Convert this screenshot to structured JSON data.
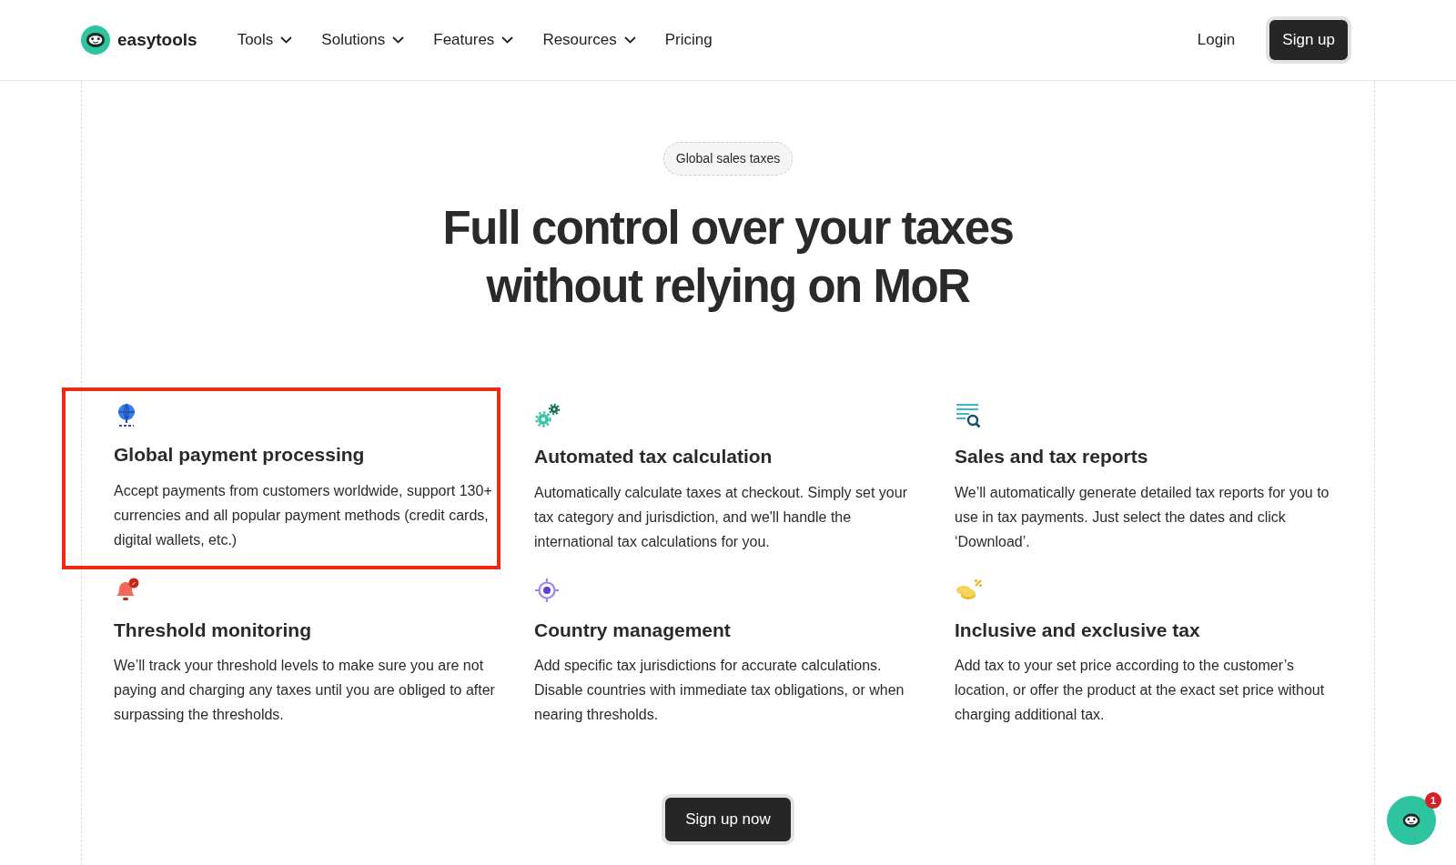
{
  "brand": {
    "name": "easytools"
  },
  "nav": [
    {
      "label": "Tools",
      "dropdown": true
    },
    {
      "label": "Solutions",
      "dropdown": true
    },
    {
      "label": "Features",
      "dropdown": true
    },
    {
      "label": "Resources",
      "dropdown": true
    },
    {
      "label": "Pricing",
      "dropdown": false
    }
  ],
  "login": "Login",
  "signup": "Sign up",
  "badge": "Global sales taxes",
  "heading": [
    "Full control over your taxes",
    "without relying on MoR"
  ],
  "features": [
    {
      "kind": "globe",
      "title": "Global payment processing",
      "text": "Accept payments from customers worldwide, support 130+ currencies and all popular payment methods (credit cards, digital wallets, etc.)",
      "highlighted": true
    },
    {
      "kind": "gears",
      "title": "Automated tax calculation",
      "text": "Automatically calculate taxes at checkout. Simply set your tax category and jurisdiction, and we'll handle the international tax calculations for you.",
      "highlighted": false
    },
    {
      "kind": "report",
      "title": "Sales and tax reports",
      "text": "We’ll automatically generate detailed tax reports for you to use in tax payments. Just select the dates and click ‘Download’.",
      "highlighted": false
    },
    {
      "kind": "bell",
      "title": "Threshold monitoring",
      "text": "We’ll track your threshold levels to make sure you are not paying and charging any taxes until you are obliged to after surpassing the thresholds.",
      "highlighted": false
    },
    {
      "kind": "target",
      "title": "Country management",
      "text": "Add specific tax jurisdictions for accurate calculations. Disable countries with immediate tax obligations, or when nearing thresholds.",
      "highlighted": false
    },
    {
      "kind": "coins",
      "title": "Inclusive and exclusive tax",
      "text": "Add tax to your set price according to the customer’s location, or offer the product at the exact set price without charging additional tax.",
      "highlighted": false
    }
  ],
  "cta": "Sign up now",
  "chat": {
    "unread": "1"
  }
}
